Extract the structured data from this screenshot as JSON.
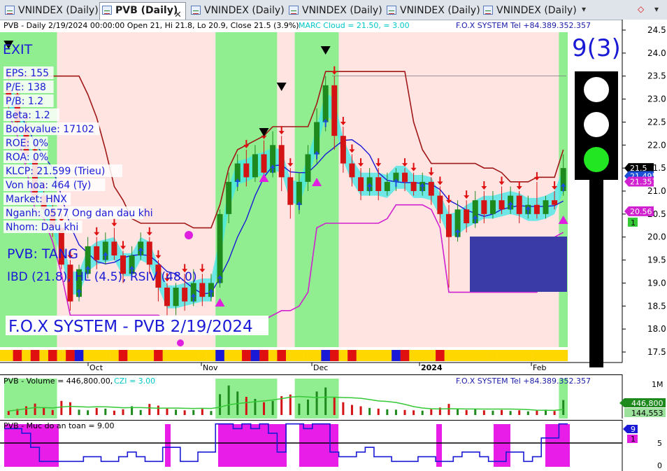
{
  "tabs": [
    {
      "label": "VNINDEX (Daily)",
      "active": false
    },
    {
      "label": "PVB (Daily)",
      "active": true
    },
    {
      "label": "VNINDEX (Daily)",
      "active": false
    },
    {
      "label": "VNINDEX (Daily)",
      "active": false
    },
    {
      "label": "VNINDEX (Daily)",
      "active": false
    },
    {
      "label": "VNINDEX (Daily)",
      "active": false
    }
  ],
  "tab_controls": {
    "close": "✕",
    "more": "▾",
    "add": "◇"
  },
  "main": {
    "header_left": "PVB - Daily 2/19/2024 00:00:00 Open 21, Hi 21.8, Lo 20.9, Close 21.5 (3.9%)",
    "header_cloud": "MARC Cloud = 21.50,  = 3.00",
    "header_right": "F.O.X SYSTEM Tel +84.389.352.357",
    "exit_label": "EXIT",
    "fundamentals": [
      "EPS: 155",
      "P/E: 138",
      "P/B: 1.2",
      "Beta: 1.2",
      "Bookvalue: 17102",
      "ROE: 0%",
      "ROA: 0%",
      "KLCP: 21.599 (Trieu)",
      "Von hoa: 464 (Ty)",
      "Market: HNX",
      "Nganh: 0577 Ong dan dau khi",
      "Nhom: Dau khi"
    ],
    "signal": "PVB: TANG",
    "indicators": "IBD (21.8), HL (4.5), RSIV (48.0)",
    "watermark": "F.O.X SYSTEM - PVB 2/19/2024",
    "score": "9(3)",
    "price_axis": [
      "24.5",
      "24.0",
      "23.5",
      "23.0",
      "22.5",
      "22.0",
      "21.5",
      "21.0",
      "20.5",
      "20.0",
      "19.5",
      "19.0",
      "18.5",
      "18.0",
      "17.5"
    ],
    "price_tags": [
      {
        "text": "21.5",
        "bg": "#000000",
        "fg": "#ffffff"
      },
      {
        "text": "21.4951",
        "bg": "#1a4fd6",
        "fg": "#ffffff"
      },
      {
        "text": "21.357",
        "bg": "#d020d0",
        "fg": "#ffffff"
      },
      {
        "text": "20.56",
        "bg": "#d020d0",
        "fg": "#ffffff"
      },
      {
        "text": "1",
        "bg": "#36c936",
        "fg": "#ffffff"
      }
    ],
    "month_labels": [
      "Oct",
      "Nov",
      "Dec",
      "2024",
      "Jan",
      "Feb"
    ]
  },
  "volume": {
    "header_left": "PVB - Volume = 446,800.00,",
    "header_czi": "CZI = 3.00",
    "header_right": "F.O.X SYSTEM Tel +84.389.352.357",
    "axis_top": "1M",
    "tag_vol": "446,800",
    "tag_ma": "144,553"
  },
  "safety": {
    "header": "PVB - Muc do an toan = 9.00",
    "axis": [
      "5",
      "0"
    ],
    "tag_9": "9",
    "tag_1": "1"
  },
  "chart_data": {
    "type": "candlestick",
    "ylim": [
      17.3,
      24.7
    ],
    "last_close": 21.5,
    "trend_bands": [
      {
        "from": 0,
        "to": 6,
        "color": "#90ee90"
      },
      {
        "from": 6,
        "to": 24,
        "color": "#ffe4e1"
      },
      {
        "from": 24,
        "to": 31,
        "color": "#90ee90"
      },
      {
        "from": 31,
        "to": 33,
        "color": "#ffe4e1"
      },
      {
        "from": 33,
        "to": 38,
        "color": "#90ee90"
      },
      {
        "from": 38,
        "to": 63,
        "color": "#ffe4e1"
      },
      {
        "from": 63,
        "to": 64,
        "color": "#90ee90"
      }
    ],
    "candles": [
      [
        23.2,
        23.0,
        23.4,
        22.8
      ],
      [
        22.9,
        22.5,
        23.0,
        22.3
      ],
      [
        22.4,
        21.8,
        22.5,
        21.6
      ],
      [
        21.7,
        20.9,
        21.8,
        20.7
      ],
      [
        20.9,
        20.6,
        21.0,
        20.5
      ],
      [
        20.6,
        20.2,
        20.7,
        20.0
      ],
      [
        20.2,
        19.4,
        20.3,
        19.3
      ],
      [
        19.4,
        18.6,
        19.5,
        18.4
      ],
      [
        18.7,
        19.3,
        19.4,
        18.6
      ],
      [
        19.2,
        19.8,
        20.0,
        19.1
      ],
      [
        19.8,
        19.5,
        20.0,
        19.3
      ],
      [
        19.5,
        19.9,
        20.1,
        19.4
      ],
      [
        19.9,
        19.6,
        20.2,
        19.5
      ],
      [
        19.6,
        19.2,
        19.7,
        19.0
      ],
      [
        19.2,
        19.6,
        19.8,
        19.1
      ],
      [
        19.6,
        19.9,
        20.1,
        19.5
      ],
      [
        19.9,
        19.4,
        20.0,
        19.2
      ],
      [
        19.4,
        18.9,
        19.5,
        18.6
      ],
      [
        18.9,
        18.5,
        19.0,
        18.3
      ],
      [
        18.5,
        18.9,
        19.0,
        18.3
      ],
      [
        18.9,
        18.6,
        19.2,
        18.4
      ],
      [
        18.6,
        19.0,
        19.3,
        18.5
      ],
      [
        19.0,
        18.7,
        19.2,
        18.5
      ],
      [
        18.7,
        19.0,
        19.2,
        18.6
      ],
      [
        19.0,
        20.5,
        20.6,
        18.9
      ],
      [
        20.5,
        21.2,
        21.4,
        20.3
      ],
      [
        21.2,
        21.6,
        21.8,
        21.0
      ],
      [
        21.6,
        21.3,
        21.9,
        21.1
      ],
      [
        21.3,
        21.8,
        22.0,
        21.2
      ],
      [
        21.8,
        21.4,
        22.1,
        21.2
      ],
      [
        21.4,
        22.0,
        22.3,
        21.3
      ],
      [
        22.0,
        21.3,
        22.2,
        21.0
      ],
      [
        21.3,
        20.7,
        21.5,
        20.4
      ],
      [
        20.7,
        21.2,
        21.4,
        20.5
      ],
      [
        21.2,
        21.8,
        22.0,
        21.0
      ],
      [
        21.8,
        22.5,
        22.8,
        21.6
      ],
      [
        22.5,
        23.3,
        23.5,
        22.3
      ],
      [
        23.3,
        22.2,
        23.5,
        21.9
      ],
      [
        22.2,
        21.6,
        22.4,
        21.4
      ],
      [
        21.6,
        21.3,
        21.8,
        21.1
      ],
      [
        21.3,
        21.0,
        21.5,
        20.8
      ],
      [
        21.0,
        21.3,
        21.5,
        20.9
      ],
      [
        21.3,
        21.0,
        21.5,
        20.8
      ],
      [
        21.0,
        21.2,
        21.4,
        20.9
      ],
      [
        21.2,
        21.4,
        21.5,
        21.0
      ],
      [
        21.4,
        21.2,
        21.5,
        21.0
      ],
      [
        21.2,
        21.0,
        21.4,
        20.9
      ],
      [
        21.0,
        21.2,
        21.4,
        20.9
      ],
      [
        21.2,
        20.9,
        21.3,
        20.7
      ],
      [
        20.9,
        20.5,
        21.1,
        20.3
      ],
      [
        20.5,
        20.0,
        20.7,
        18.9
      ],
      [
        20.0,
        20.6,
        20.8,
        19.9
      ],
      [
        20.6,
        20.3,
        20.8,
        20.1
      ],
      [
        20.3,
        20.8,
        21.0,
        20.2
      ],
      [
        20.8,
        20.5,
        21.0,
        20.3
      ],
      [
        20.5,
        20.8,
        21.0,
        20.4
      ],
      [
        20.8,
        20.6,
        21.1,
        20.5
      ],
      [
        20.6,
        20.9,
        21.1,
        20.5
      ],
      [
        20.9,
        20.5,
        21.0,
        20.3
      ],
      [
        20.5,
        20.7,
        20.9,
        20.4
      ],
      [
        20.7,
        20.5,
        21.2,
        20.4
      ],
      [
        20.5,
        20.8,
        20.9,
        20.4
      ],
      [
        20.8,
        20.7,
        21.0,
        20.6
      ],
      [
        21.0,
        21.5,
        21.8,
        20.9
      ]
    ],
    "volume_k": [
      120,
      180,
      260,
      340,
      210,
      150,
      420,
      380,
      160,
      140,
      210,
      190,
      130,
      170,
      260,
      150,
      330,
      280,
      190,
      160,
      140,
      150,
      180,
      120,
      620,
      880,
      700,
      540,
      480,
      380,
      420,
      560,
      610,
      340,
      460,
      700,
      820,
      540,
      380,
      300,
      260,
      210,
      190,
      170,
      160,
      150,
      140,
      130,
      170,
      220,
      330,
      180,
      150,
      170,
      140,
      130,
      150,
      120,
      140,
      110,
      130,
      160,
      120,
      447
    ]
  }
}
